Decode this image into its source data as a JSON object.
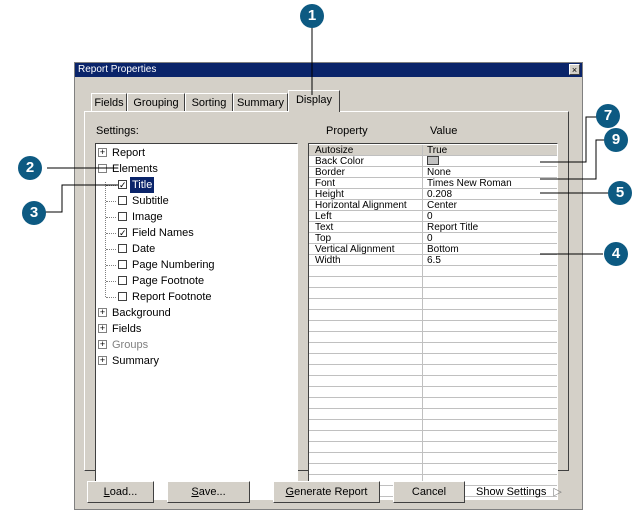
{
  "window": {
    "title": "Report Properties",
    "close_glyph": "×"
  },
  "tabs": [
    {
      "label": "Fields"
    },
    {
      "label": "Grouping"
    },
    {
      "label": "Sorting"
    },
    {
      "label": "Summary"
    },
    {
      "label": "Display",
      "active": true
    }
  ],
  "settings_label": "Settings:",
  "tree": {
    "expand_glyph": "+",
    "collapse_glyph": "−",
    "check_glyph": "✓",
    "report": "Report",
    "elements": "Elements",
    "title": "Title",
    "subtitle": "Subtitle",
    "image": "Image",
    "field_names": "Field Names",
    "date": "Date",
    "page_numbering": "Page Numbering",
    "page_footnote": "Page Footnote",
    "report_footnote": "Report Footnote",
    "background": "Background",
    "fields": "Fields",
    "groups": "Groups",
    "summary": "Summary"
  },
  "grid": {
    "property_header": "Property",
    "value_header": "Value",
    "rows": [
      {
        "property": "Autosize",
        "value": "True"
      },
      {
        "property": "Back Color",
        "value": ""
      },
      {
        "property": "Border",
        "value": "None"
      },
      {
        "property": "Font",
        "value": "Times New Roman"
      },
      {
        "property": "Height",
        "value": "0.208"
      },
      {
        "property": "Horizontal Alignment",
        "value": "Center"
      },
      {
        "property": "Left",
        "value": "0"
      },
      {
        "property": "Text",
        "value": "Report Title"
      },
      {
        "property": "Top",
        "value": "0"
      },
      {
        "property": "Vertical Alignment",
        "value": "Bottom"
      },
      {
        "property": "Width",
        "value": "6.5"
      }
    ]
  },
  "buttons": {
    "load_accel": "L",
    "load_rest": "oad...",
    "save_accel": "S",
    "save_rest": "ave...",
    "generate_accel": "G",
    "generate_rest": "enerate Report",
    "cancel": "Cancel",
    "show_settings": "Show Settings",
    "show_settings_arrow": "▷"
  },
  "callouts": {
    "c1": "1",
    "c2": "2",
    "c3": "3",
    "c4": "4",
    "c5": "5",
    "c7": "7",
    "c9": "9"
  },
  "colors": {
    "callout": "#0d5a82",
    "titlebar": "#0a246a",
    "dialog": "#d4d0c8"
  }
}
